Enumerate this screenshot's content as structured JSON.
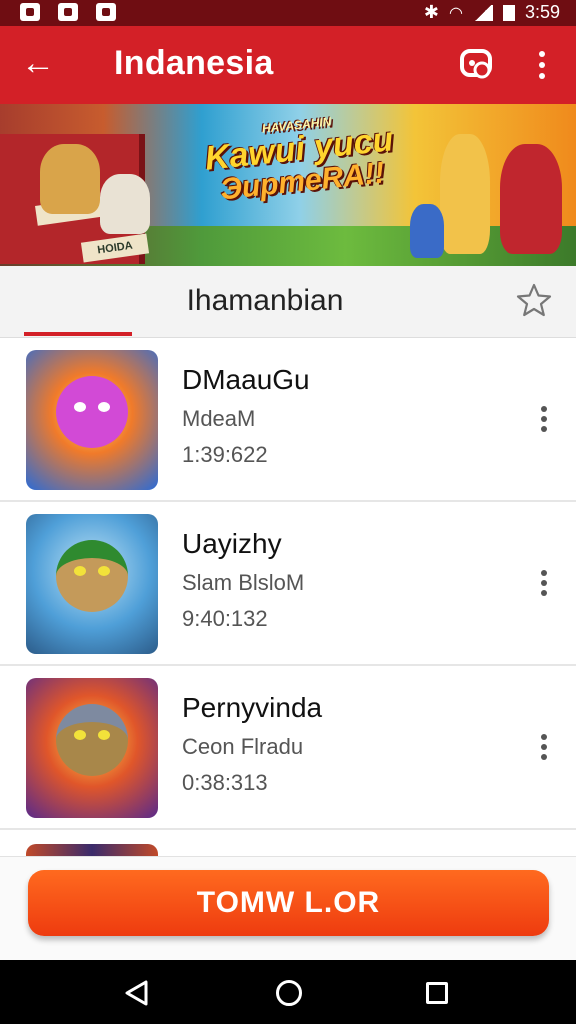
{
  "status_bar": {
    "time": "3:59"
  },
  "app_bar": {
    "title": "Indanesia"
  },
  "banner": {
    "small_text": "HAVASAHIN",
    "line1": "Kawui yucu",
    "line2": "ЭupmeRA!!",
    "sign1": "",
    "sign2": "HOIDA"
  },
  "tab": {
    "label": "Ihamanbian"
  },
  "items": [
    {
      "title": "DMaauGu",
      "subtitle": "MdeaM",
      "time": "1:39:622",
      "accent": "#c026c7"
    },
    {
      "title": "Uayizhy",
      "subtitle": "Slam BlsloM",
      "time": "9:40:132",
      "accent": "#3a8a2e"
    },
    {
      "title": "Pernyvinda",
      "subtitle": "Ceon Flradu",
      "time": "0:38:313",
      "accent": "#7a4bd6"
    }
  ],
  "cta": {
    "label": "TOMW  L.OR"
  },
  "colors": {
    "primary": "#d32027",
    "status_bar": "#6f0d12",
    "cta": "#f04a14"
  }
}
